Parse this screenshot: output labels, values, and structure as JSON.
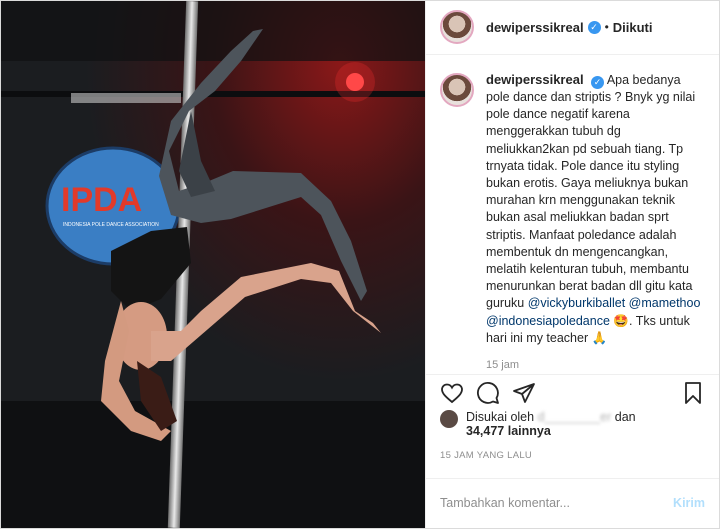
{
  "post": {
    "username": "dewiperssikreal",
    "verified_symbol": "✓",
    "separator": "•",
    "follow_status": "Diikuti",
    "logo_text": "IPDA",
    "logo_subtext": "INDONESIA POLE DANCE ASSOCIATION",
    "caption": {
      "text_part1": "Apa bedanya pole dance dan striptis ? Bnyk yg nilai pole dance negatif karena menggerakkan tubuh dg meliukkan2kan pd sebuah tiang. Tp trnyata tidak. Pole dance itu styling bukan erotis. Gaya meliuknya bukan murahan krn menggunakan teknik bukan asal meliukkan badan sprt striptis. Manfaat poledance adalah membentuk dn mengencangkan, melatih kelenturan tubuh, membantu menurunkan berat badan dll gitu kata guruku",
      "mention1": "@vickyburkiballet",
      "mention2": "@mamethoo",
      "mention3": "@indonesiapoledance",
      "emoji1": "🤩",
      "text_part2": ". Tks untuk hari ini my teacher",
      "emoji2": "🙏",
      "age": "15 jam"
    },
    "likes": {
      "prefix": "Disukai oleh",
      "blurred_name": "d________er",
      "conjunction": "dan",
      "count": "34,477",
      "suffix": "lainnya"
    },
    "timestamp": "15 JAM YANG LALU",
    "comment": {
      "placeholder": "Tambahkan komentar...",
      "submit_label": "Kirim"
    }
  }
}
